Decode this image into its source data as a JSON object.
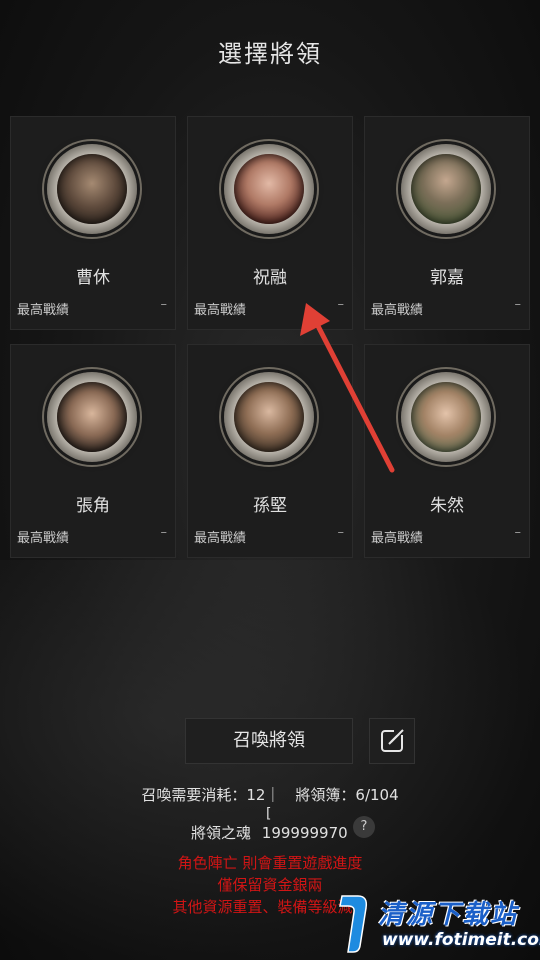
{
  "title": "選擇將領",
  "generals": [
    {
      "name": "曹休",
      "record_label": "最高戰績",
      "record_value": "–"
    },
    {
      "name": "祝融",
      "record_label": "最高戰績",
      "record_value": "–"
    },
    {
      "name": "郭嘉",
      "record_label": "最高戰績",
      "record_value": "–"
    },
    {
      "name": "張角",
      "record_label": "最高戰績",
      "record_value": "–"
    },
    {
      "name": "孫堅",
      "record_label": "最高戰績",
      "record_value": "–"
    },
    {
      "name": "朱然",
      "record_label": "最高戰績",
      "record_value": "–"
    }
  ],
  "summon_button": "召喚將領",
  "cost_line": "召喚需要消耗：12｜　將領簿：6/104",
  "bracket": "[",
  "soul_label": "將領之魂",
  "soul_value": "199999970",
  "help_symbol": "?",
  "warnings": [
    "角色陣亡 則會重置遊戲進度",
    "僅保留資金銀兩",
    "其他資源重置、裝備等級減半"
  ],
  "watermark": {
    "text": "清源下载站",
    "url": "www.fotimeit.com"
  },
  "colors": {
    "warning": "#d01515",
    "arrow": "#e04035",
    "watermark": "#1a5fc8"
  },
  "icons": {
    "edit": "edit-icon",
    "help": "question-icon"
  }
}
